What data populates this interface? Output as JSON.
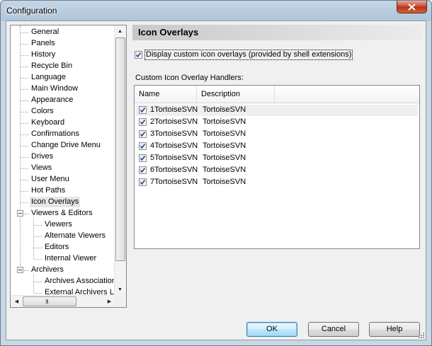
{
  "window": {
    "title": "Configuration"
  },
  "tree": {
    "items": [
      {
        "label": "General",
        "level": 1
      },
      {
        "label": "Panels",
        "level": 1
      },
      {
        "label": "History",
        "level": 1
      },
      {
        "label": "Recycle Bin",
        "level": 1
      },
      {
        "label": "Language",
        "level": 1
      },
      {
        "label": "Main Window",
        "level": 1
      },
      {
        "label": "Appearance",
        "level": 1
      },
      {
        "label": "Colors",
        "level": 1
      },
      {
        "label": "Keyboard",
        "level": 1
      },
      {
        "label": "Confirmations",
        "level": 1
      },
      {
        "label": "Change Drive Menu",
        "level": 1
      },
      {
        "label": "Drives",
        "level": 1
      },
      {
        "label": "Views",
        "level": 1
      },
      {
        "label": "User Menu",
        "level": 1
      },
      {
        "label": "Hot Paths",
        "level": 1
      },
      {
        "label": "Icon Overlays",
        "level": 1,
        "selected": true
      },
      {
        "label": "Viewers & Editors",
        "level": 1,
        "expander": true
      },
      {
        "label": "Viewers",
        "level": 2
      },
      {
        "label": "Alternate Viewers",
        "level": 2
      },
      {
        "label": "Editors",
        "level": 2
      },
      {
        "label": "Internal Viewer",
        "level": 2
      },
      {
        "label": "Archivers",
        "level": 1,
        "expander": true
      },
      {
        "label": "Archives Associations",
        "level": 2
      },
      {
        "label": "External Archivers Lo",
        "level": 2
      }
    ],
    "hscroll_grip": "III"
  },
  "panel": {
    "title": "Icon Overlays",
    "display_overlays_label": "Display custom icon overlays (provided by shell extensions)",
    "display_overlays_checked": true,
    "group_label": "Custom Icon Overlay Handlers:",
    "columns": [
      "Name",
      "Description"
    ],
    "rows": [
      {
        "name": "1TortoiseSVN",
        "description": "TortoiseSVN",
        "checked": true
      },
      {
        "name": "2TortoiseSVN",
        "description": "TortoiseSVN",
        "checked": true
      },
      {
        "name": "3TortoiseSVN",
        "description": "TortoiseSVN",
        "checked": true
      },
      {
        "name": "4TortoiseSVN",
        "description": "TortoiseSVN",
        "checked": true
      },
      {
        "name": "5TortoiseSVN",
        "description": "TortoiseSVN",
        "checked": true
      },
      {
        "name": "6TortoiseSVN",
        "description": "TortoiseSVN",
        "checked": true
      },
      {
        "name": "7TortoiseSVN",
        "description": "TortoiseSVN",
        "checked": true
      }
    ]
  },
  "buttons": {
    "ok": "OK",
    "cancel": "Cancel",
    "help": "Help"
  },
  "colors": {
    "selection": "#e6e6e6",
    "default_button_border": "#3c7fb1",
    "close_button": "#c7442f"
  }
}
